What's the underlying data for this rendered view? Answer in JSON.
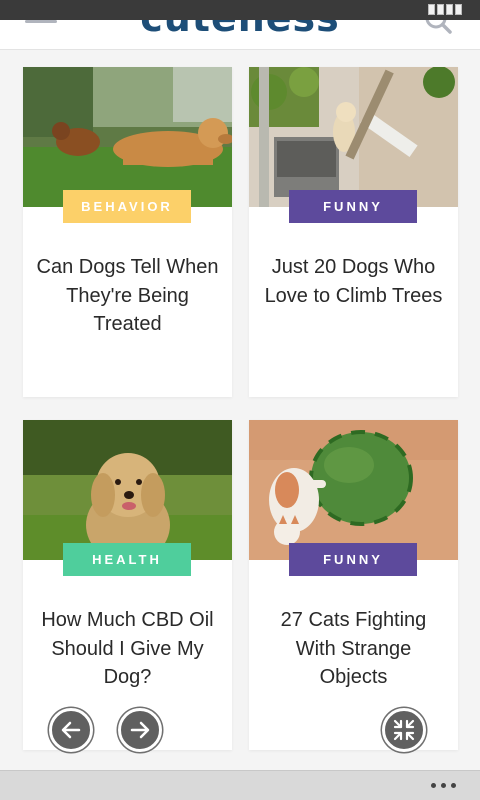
{
  "header": {
    "logo_text": "cuteness"
  },
  "cards": [
    {
      "category": "BEHAVIOR",
      "title": "Can Dogs Tell When They're Being Treated",
      "category_color": "#fcd069"
    },
    {
      "category": "FUNNY",
      "title": "Just 20 Dogs Who Love to Climb Trees",
      "category_color": "#5d4a9c"
    },
    {
      "category": "HEALTH",
      "title": "How Much CBD Oil Should I Give My Dog?",
      "category_color": "#4fce9c"
    },
    {
      "category": "FUNNY",
      "title": "27 Cats Fighting With Strange Objects",
      "category_color": "#5d4a9c"
    }
  ],
  "controls": {
    "back_icon": "arrow-left-icon",
    "forward_icon": "arrow-right-icon",
    "collapse_icon": "collapse-icon"
  },
  "bottom_bar": {
    "more_icon": "more-icon"
  },
  "colors": {
    "logo": "#1d4e78",
    "background": "#f4f4f4"
  }
}
